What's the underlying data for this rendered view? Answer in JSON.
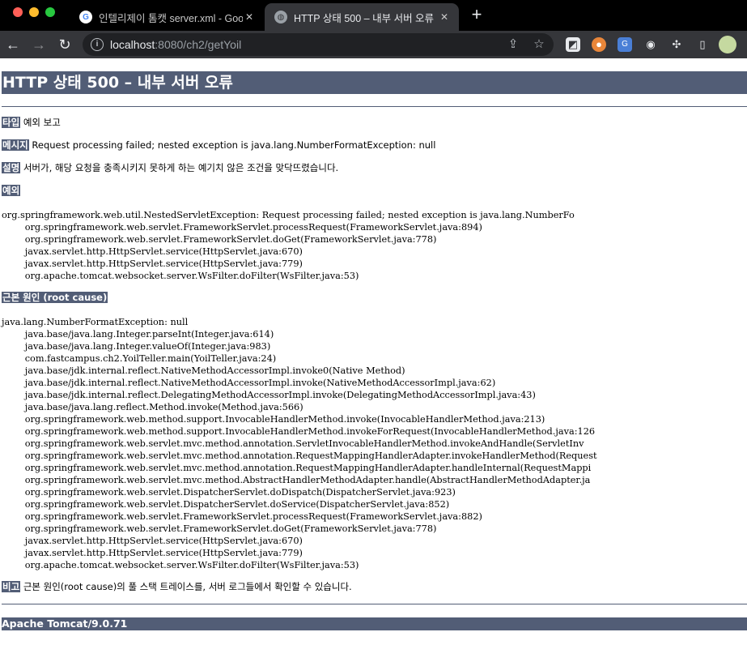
{
  "browser": {
    "tabs": [
      {
        "title": "인텔리제이 톰캣 server.xml - Goo",
        "favicon": "google-icon",
        "active": false
      },
      {
        "title": "HTTP 상태 500 – 내부 서버 오류",
        "favicon": "globe-icon",
        "active": true
      }
    ],
    "address": {
      "host": "localhost",
      "path": ":8080/ch2/getYoil"
    }
  },
  "page": {
    "heading": "HTTP 상태 500 – 내부 서버 오류",
    "type_label": "타입",
    "type_value": "예외 보고",
    "message_label": "메시지",
    "message_value": "Request processing failed; nested exception is java.lang.NumberFormatException: null",
    "description_label": "설명",
    "description_value": "서버가, 해당 요청을 충족시키지 못하게 하는 예기치 않은 조건을 맞닥뜨렸습니다.",
    "exception_label": "예외",
    "exception_trace": [
      "org.springframework.web.util.NestedServletException: Request processing failed; nested exception is java.lang.NumberFo",
      "\torg.springframework.web.servlet.FrameworkServlet.processRequest(FrameworkServlet.java:894)",
      "\torg.springframework.web.servlet.FrameworkServlet.doGet(FrameworkServlet.java:778)",
      "\tjavax.servlet.http.HttpServlet.service(HttpServlet.java:670)",
      "\tjavax.servlet.http.HttpServlet.service(HttpServlet.java:779)",
      "\torg.apache.tomcat.websocket.server.WsFilter.doFilter(WsFilter.java:53)"
    ],
    "root_cause_label": "근본 원인 (root cause)",
    "root_cause_trace": [
      "java.lang.NumberFormatException: null",
      "\tjava.base/java.lang.Integer.parseInt(Integer.java:614)",
      "\tjava.base/java.lang.Integer.valueOf(Integer.java:983)",
      "\tcom.fastcampus.ch2.YoilTeller.main(YoilTeller.java:24)",
      "\tjava.base/jdk.internal.reflect.NativeMethodAccessorImpl.invoke0(Native Method)",
      "\tjava.base/jdk.internal.reflect.NativeMethodAccessorImpl.invoke(NativeMethodAccessorImpl.java:62)",
      "\tjava.base/jdk.internal.reflect.DelegatingMethodAccessorImpl.invoke(DelegatingMethodAccessorImpl.java:43)",
      "\tjava.base/java.lang.reflect.Method.invoke(Method.java:566)",
      "\torg.springframework.web.method.support.InvocableHandlerMethod.invoke(InvocableHandlerMethod.java:213)",
      "\torg.springframework.web.method.support.InvocableHandlerMethod.invokeForRequest(InvocableHandlerMethod.java:126",
      "\torg.springframework.web.servlet.mvc.method.annotation.ServletInvocableHandlerMethod.invokeAndHandle(ServletInv",
      "\torg.springframework.web.servlet.mvc.method.annotation.RequestMappingHandlerAdapter.invokeHandlerMethod(Request",
      "\torg.springframework.web.servlet.mvc.method.annotation.RequestMappingHandlerAdapter.handleInternal(RequestMappi",
      "\torg.springframework.web.servlet.mvc.method.AbstractHandlerMethodAdapter.handle(AbstractHandlerMethodAdapter.ja",
      "\torg.springframework.web.servlet.DispatcherServlet.doDispatch(DispatcherServlet.java:923)",
      "\torg.springframework.web.servlet.DispatcherServlet.doService(DispatcherServlet.java:852)",
      "\torg.springframework.web.servlet.FrameworkServlet.processRequest(FrameworkServlet.java:882)",
      "\torg.springframework.web.servlet.FrameworkServlet.doGet(FrameworkServlet.java:778)",
      "\tjavax.servlet.http.HttpServlet.service(HttpServlet.java:670)",
      "\tjavax.servlet.http.HttpServlet.service(HttpServlet.java:779)",
      "\torg.apache.tomcat.websocket.server.WsFilter.doFilter(WsFilter.java:53)"
    ],
    "note_label": "비고",
    "note_value": "근본 원인(root cause)의 풀 스택 트레이스를, 서버 로그들에서 확인할 수 있습니다.",
    "footer": "Apache Tomcat/9.0.71"
  },
  "colors": {
    "tomcat_header": "#525d76",
    "tab_strip": "#000000",
    "toolbar": "#35363a"
  }
}
